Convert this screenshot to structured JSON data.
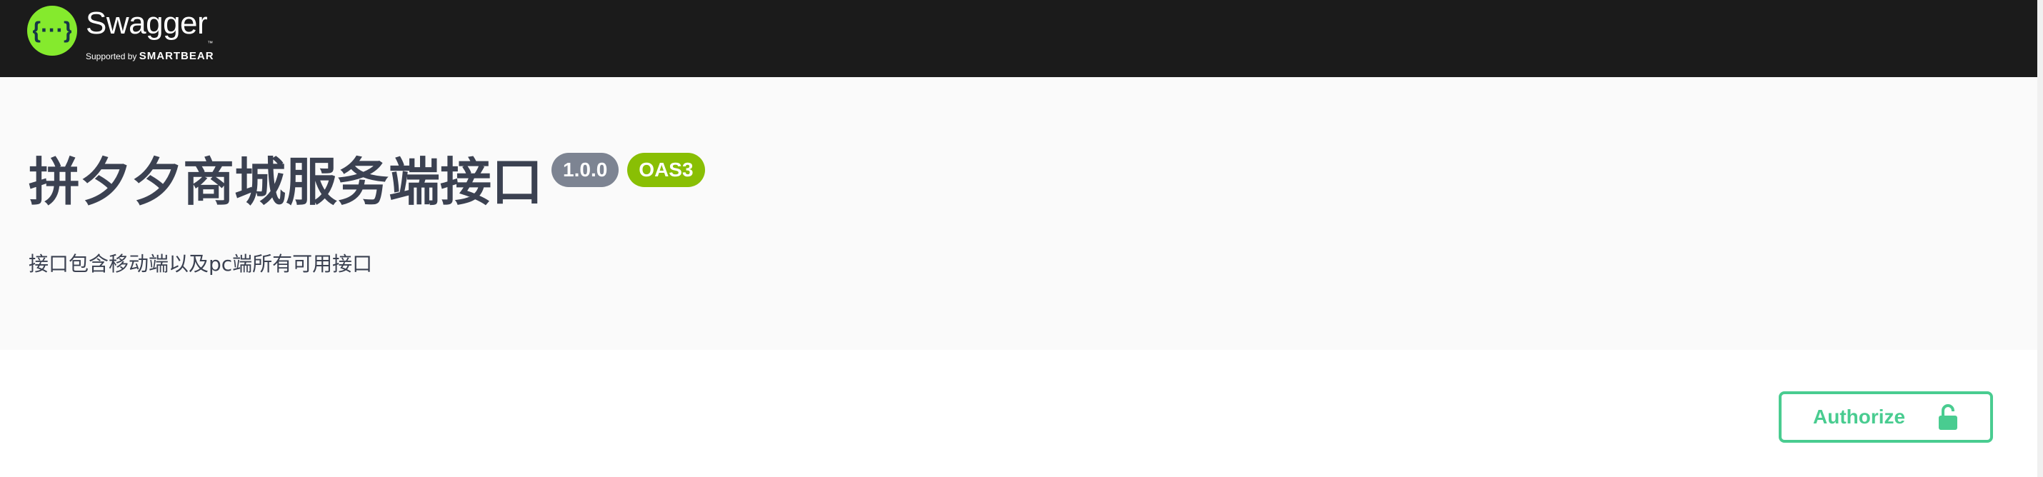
{
  "topbar": {
    "logo_name": "Swagger",
    "logo_tm": "™",
    "logo_supported_by": "Supported by",
    "logo_company": "SMARTBEAR",
    "logo_icon": "swagger-braces-icon",
    "logo_icon_text": "{···}"
  },
  "info": {
    "title": "拼夕夕商城服务端接口",
    "version_badge": "1.0.0",
    "oas_badge": "OAS3",
    "description": "接口包含移动端以及pc端所有可用接口"
  },
  "scheme": {
    "authorize_label": "Authorize",
    "authorize_icon": "unlocked-padlock-icon"
  },
  "colors": {
    "topbar_bg": "#1b1b1b",
    "logo_green": "#85ea2d",
    "info_bg": "#fafafa",
    "title_text": "#3b4151",
    "version_badge_bg": "#7d8492",
    "oas_badge_bg": "#89bf04",
    "authorize_green": "#49cc90"
  }
}
